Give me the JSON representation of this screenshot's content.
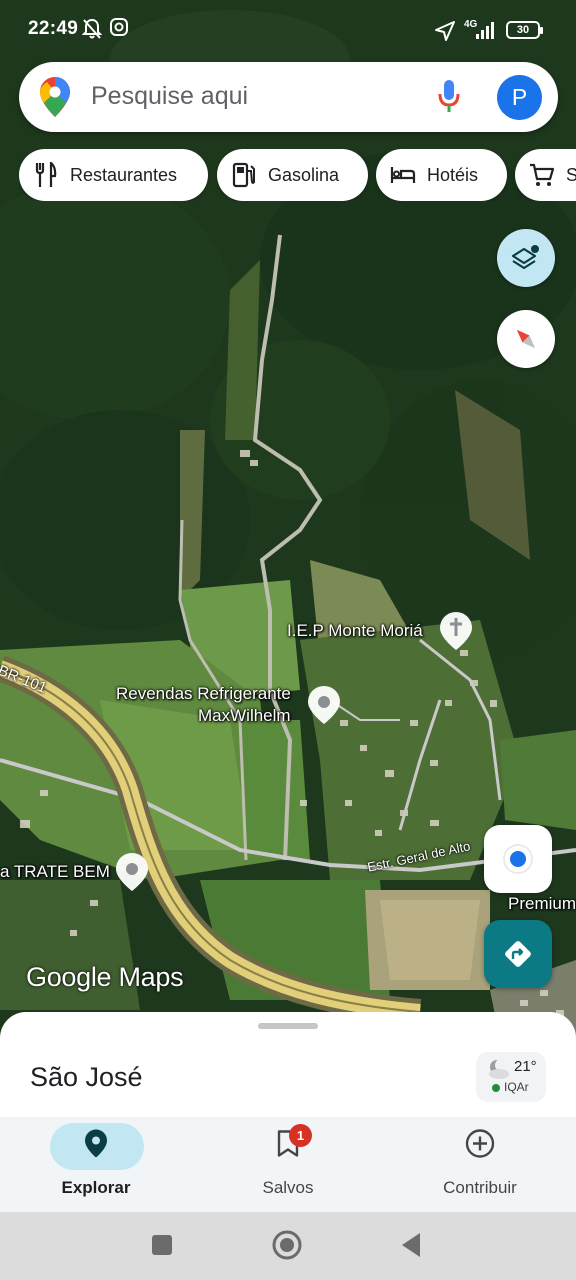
{
  "status_bar": {
    "time": "22:49",
    "network": "4G",
    "battery": "30"
  },
  "search": {
    "placeholder": "Pesquise aqui",
    "avatar_initial": "P"
  },
  "chips": [
    {
      "label": "Restaurantes",
      "icon": "fork-knife-icon"
    },
    {
      "label": "Gasolina",
      "icon": "gas-station-icon"
    },
    {
      "label": "Hotéis",
      "icon": "bed-icon"
    },
    {
      "label": "S",
      "icon": "cart-icon"
    }
  ],
  "map": {
    "labels": {
      "church": "I.E.P Monte Moriá",
      "store_line1": "Revendas Refrigerante",
      "store_line2": "MaxWilhelm",
      "trate": "a TRATE BEM",
      "premium": "Premium",
      "highway": "BR-101",
      "road": "Estr. Geral de Alto"
    },
    "watermark": "Google Maps",
    "colors": {
      "forest": "#1f3a1f",
      "highway": "#e2cf7a",
      "road": "#c9c9c9"
    }
  },
  "sheet": {
    "title": "São José",
    "temperature": "21°",
    "aqi_label": "IQAr"
  },
  "bottom_nav": [
    {
      "label": "Explorar",
      "icon": "explore-pin-icon",
      "active": true
    },
    {
      "label": "Salvos",
      "icon": "bookmark-icon",
      "badge": "1"
    },
    {
      "label": "Contribuir",
      "icon": "plus-circle-icon"
    }
  ]
}
